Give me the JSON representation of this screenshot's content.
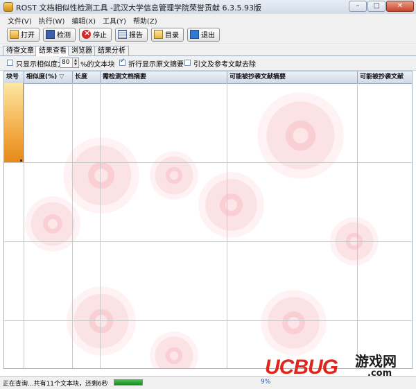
{
  "window": {
    "title": "ROST 文档相似性检测工具 -武汉大学信息管理学院荣誉贡献 6.3.5.93版"
  },
  "menu": [
    "文件(V)",
    "执行(W)",
    "编辑(X)",
    "工具(Y)",
    "帮助(Z)"
  ],
  "toolbar": {
    "open": "打开",
    "check": "检测",
    "stop": "停止",
    "report": "报告",
    "dir": "目录",
    "exit": "退出"
  },
  "tabs": [
    "待查文章",
    "结果查看",
    "浏览器",
    "结果分析"
  ],
  "active_tab": "结果查看",
  "options": {
    "show_only_prefix": "只显示相似度大",
    "threshold": "80",
    "show_only_suffix": "%的文本块",
    "wrap_label": "折行显示原文摘要",
    "wrap_checked": true,
    "show_only_checked": false,
    "citation_label": "引文及参考文献去除",
    "citation_checked": false
  },
  "table": {
    "columns": [
      "块号",
      "相似度(%)",
      "长度",
      "需检测文档摘要",
      "可能被抄袭文献摘要",
      "可能被抄袭文献"
    ],
    "sort_arrow": "▽",
    "rows": []
  },
  "status": {
    "text": "正在查询...共有11个文本块，还剩6秒",
    "percent_label": "9%",
    "progress": 0.09
  },
  "watermark": {
    "brand": "UCBUG",
    "cn": "游戏网",
    "domain": ".com"
  },
  "colors": {
    "accent": "#2a57a8",
    "row_highlight": "#f1a33a",
    "watermark": "#e0261c"
  }
}
